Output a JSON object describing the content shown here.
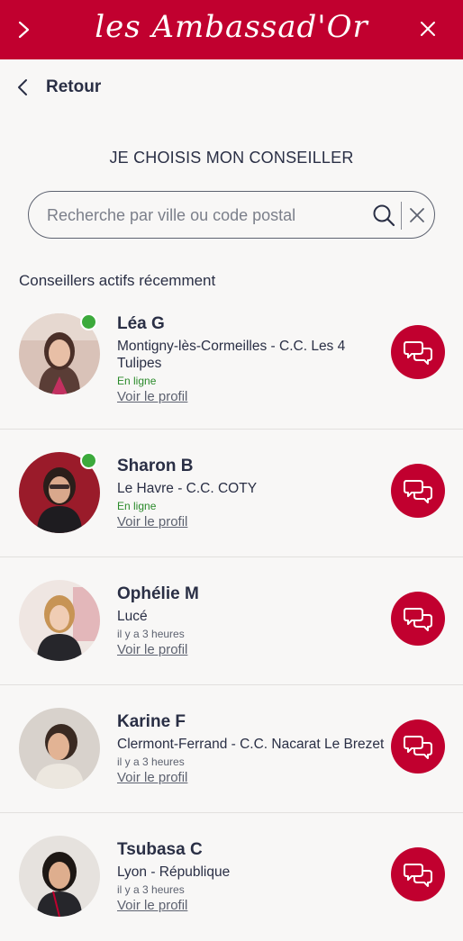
{
  "header": {
    "brand": "les Ambassad'Or"
  },
  "nav": {
    "back_label": "Retour"
  },
  "page": {
    "title": "JE CHOISIS MON CONSEILLER"
  },
  "search": {
    "placeholder": "Recherche par ville ou code postal",
    "value": ""
  },
  "section_title": "Conseillers actifs récemment",
  "advisors": [
    {
      "name": "Léa G",
      "location": "Montigny-lès-Cormeilles - C.C. Les 4 Tulipes",
      "status": "En ligne",
      "online": true,
      "profile_link": "Voir le profil"
    },
    {
      "name": "Sharon B",
      "location": "Le Havre - C.C. COTY",
      "status": "En ligne",
      "online": true,
      "profile_link": "Voir le profil"
    },
    {
      "name": "Ophélie M",
      "location": "Lucé",
      "status": "il y a 3 heures",
      "online": false,
      "profile_link": "Voir le profil"
    },
    {
      "name": "Karine F",
      "location": "Clermont-Ferrand - C.C. Nacarat Le Brezet",
      "status": "il y a 3 heures",
      "online": false,
      "profile_link": "Voir le profil"
    },
    {
      "name": "Tsubasa C",
      "location": "Lyon - République",
      "status": "il y a 3 heures",
      "online": false,
      "profile_link": "Voir le profil"
    }
  ],
  "colors": {
    "brand_red": "#c1002f",
    "online_green": "#3caa3c",
    "text_dark": "#2a2f45",
    "background": "#f8f7f6"
  },
  "icons": {
    "menu": "chevron-right-icon",
    "close": "close-icon",
    "back": "chevron-left-icon",
    "search": "search-icon",
    "clear": "clear-icon",
    "chat": "chat-bubbles-icon"
  }
}
